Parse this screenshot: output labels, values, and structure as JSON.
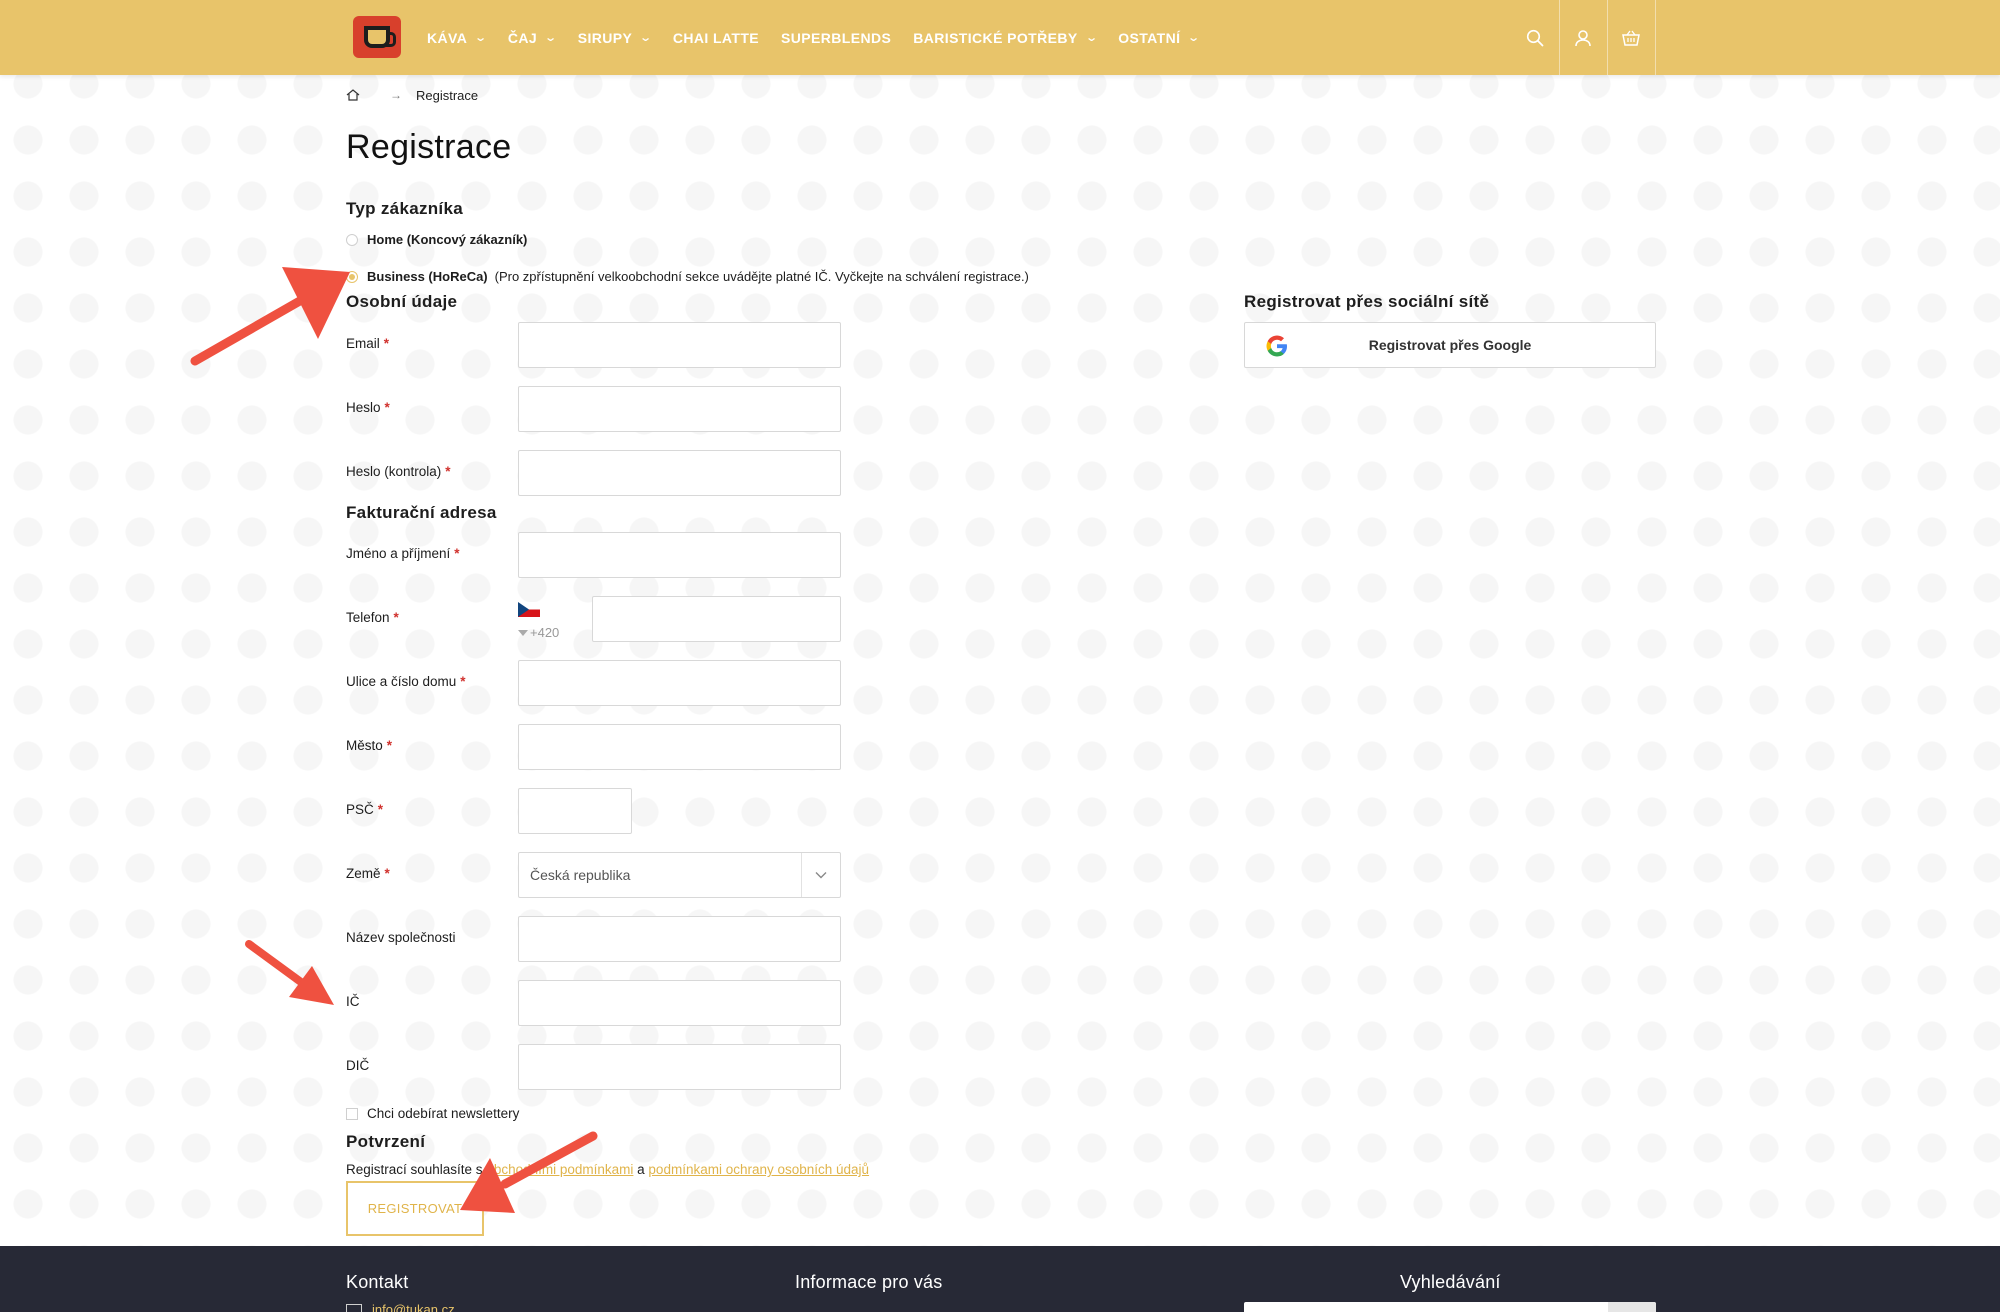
{
  "colors": {
    "header_bg": "#e8c46a",
    "accent": "#e0b44a",
    "required": "#d0312d",
    "arrow": "#ef5140",
    "footer_bg": "#272936"
  },
  "header": {
    "logo_icon": "coffee-cup-logo-icon",
    "nav": [
      {
        "label": "KÁVA",
        "has_dropdown": true
      },
      {
        "label": "ČAJ",
        "has_dropdown": true
      },
      {
        "label": "SIRUPY",
        "has_dropdown": true
      },
      {
        "label": "CHAI LATTE",
        "has_dropdown": false
      },
      {
        "label": "SUPERBLENDS",
        "has_dropdown": false
      },
      {
        "label": "BARISTICKÉ POTŘEBY",
        "has_dropdown": true
      },
      {
        "label": "OSTATNÍ",
        "has_dropdown": true
      }
    ],
    "icons": [
      "search-icon",
      "user-icon",
      "basket-icon"
    ]
  },
  "breadcrumb": {
    "home_icon": "home-icon",
    "separator": "→",
    "current": "Registrace"
  },
  "page_title": "Registrace",
  "customer_type": {
    "heading": "Typ zákazníka",
    "options": [
      {
        "label": "Home (Koncový zákazník)",
        "note": "",
        "selected": false
      },
      {
        "label": "Business (HoReCa)",
        "note": "(Pro zpřístupnění velkoobchodní sekce uvádějte platné IČ. Vyčkejte na schválení registrace.)",
        "selected": true
      }
    ]
  },
  "personal": {
    "heading": "Osobní údaje",
    "email_label": "Email",
    "password_label": "Heslo",
    "password_check_label": "Heslo (kontrola)",
    "required_mark": "*"
  },
  "billing": {
    "heading": "Fakturační adresa",
    "name_label": "Jméno a příjmení",
    "phone_label": "Telefon",
    "phone_prefix": "+420",
    "phone_flag": "czech-flag-icon",
    "street_label": "Ulice a číslo domu",
    "city_label": "Město",
    "zip_label": "PSČ",
    "country_label": "Země",
    "country_value": "Česká republika",
    "company_label": "Název společnosti",
    "ic_label": "IČ",
    "dic_label": "DIČ"
  },
  "newsletter": {
    "label": "Chci odebírat newslettery",
    "checked": false
  },
  "confirmation": {
    "heading": "Potvrzení",
    "text_before": "Registrací souhlasíte s ",
    "terms_link": "obchodními podmínkami",
    "text_middle": " a ",
    "privacy_link": "podmínkami ochrany osobních údajů",
    "submit_label": "REGISTROVAT"
  },
  "social": {
    "heading": "Registrovat přes sociální sítě",
    "google_label": "Registrovat přes Google",
    "google_icon": "google-icon"
  },
  "footer": {
    "contact_heading": "Kontakt",
    "contact_email": "info@tukan.cz",
    "info_heading": "Informace pro vás",
    "search_heading": "Vyhledávání",
    "mail_icon": "envelope-icon"
  }
}
